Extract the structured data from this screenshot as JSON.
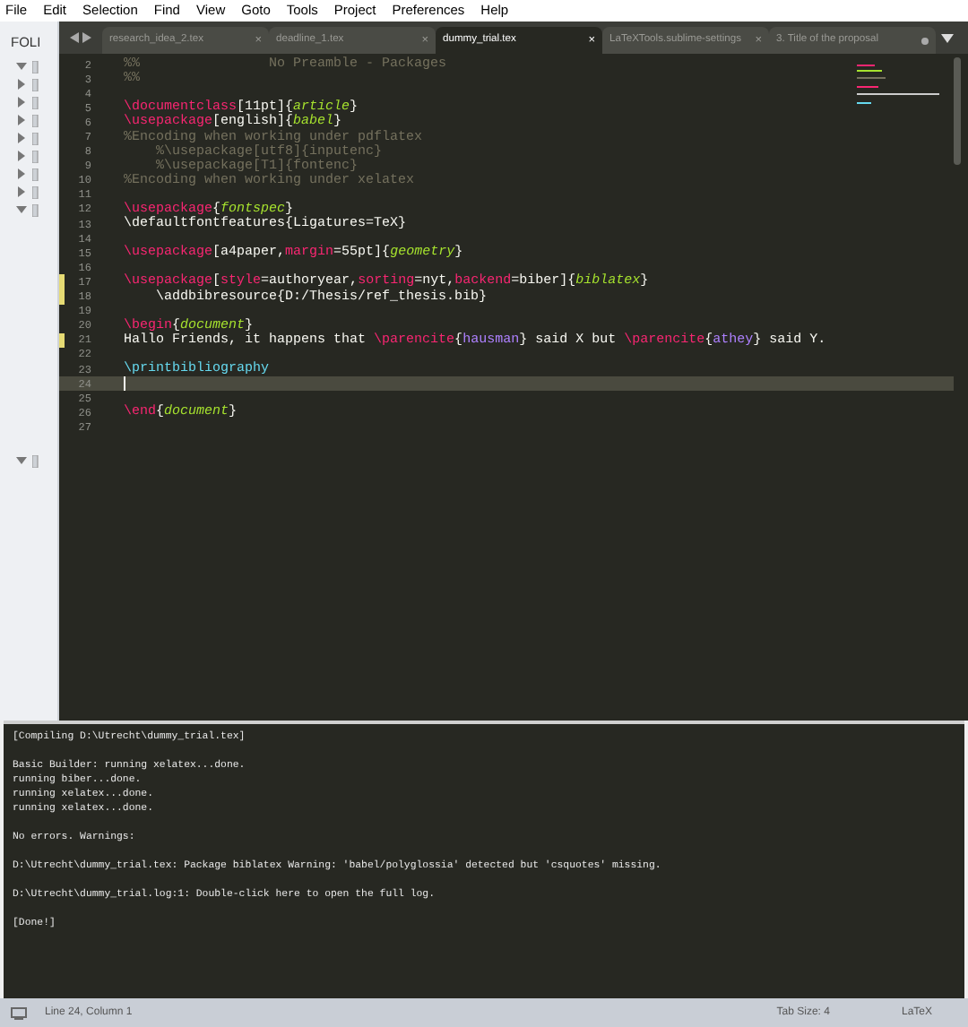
{
  "menu": [
    "File",
    "Edit",
    "Selection",
    "Find",
    "View",
    "Goto",
    "Tools",
    "Project",
    "Preferences",
    "Help"
  ],
  "sidebar": {
    "header": "FOLI",
    "items": [
      {
        "expanded": true
      },
      {
        "expanded": false
      },
      {
        "expanded": false
      },
      {
        "expanded": false
      },
      {
        "expanded": false
      },
      {
        "expanded": false
      },
      {
        "expanded": false
      },
      {
        "expanded": false
      },
      {
        "expanded": true
      },
      {
        "expanded": true
      }
    ]
  },
  "tabs": [
    {
      "label": "research_idea_2.tex",
      "close": "×",
      "selected": false,
      "dirty": false
    },
    {
      "label": "deadline_1.tex",
      "close": "×",
      "selected": false,
      "dirty": false
    },
    {
      "label": "dummy_trial.tex",
      "close": "×",
      "selected": true,
      "dirty": false
    },
    {
      "label": "LaTeXTools.sublime-settings",
      "close": "×",
      "selected": false,
      "dirty": false
    },
    {
      "label": "3. Title of the proposal",
      "selected": false,
      "dirty": true
    }
  ],
  "editor": {
    "lines": [
      {
        "number": "2",
        "modified": false,
        "current": false,
        "tokens": [
          {
            "kind": "comment",
            "text": "%%                No Preamble - Packages"
          }
        ]
      },
      {
        "number": "3",
        "modified": false,
        "current": false,
        "tokens": [
          {
            "kind": "comment",
            "text": "%%"
          }
        ]
      },
      {
        "number": "4",
        "modified": false,
        "current": false
      },
      {
        "number": "5",
        "modified": false,
        "current": false,
        "tokens": [
          {
            "kind": "cmd",
            "text": "\\documentclass"
          },
          {
            "kind": "plain",
            "text": "[11pt]{"
          },
          {
            "kind": "arg",
            "text": "article"
          },
          {
            "kind": "plain",
            "text": "}"
          }
        ]
      },
      {
        "number": "6",
        "modified": false,
        "current": false,
        "tokens": [
          {
            "kind": "cmd",
            "text": "\\usepackage"
          },
          {
            "kind": "plain",
            "text": "[english]{"
          },
          {
            "kind": "arg",
            "text": "babel"
          },
          {
            "kind": "plain",
            "text": "}"
          }
        ]
      },
      {
        "number": "7",
        "modified": false,
        "current": false,
        "tokens": [
          {
            "kind": "comment",
            "text": "%Encoding when working under pdflatex"
          }
        ]
      },
      {
        "number": "8",
        "modified": false,
        "current": false,
        "tokens": [
          {
            "kind": "comment",
            "text": "    %\\usepackage[utf8]{inputenc}"
          }
        ]
      },
      {
        "number": "9",
        "modified": false,
        "current": false,
        "tokens": [
          {
            "kind": "comment",
            "text": "    %\\usepackage[T1]{fontenc}"
          }
        ]
      },
      {
        "number": "10",
        "modified": false,
        "current": false,
        "tokens": [
          {
            "kind": "comment",
            "text": "%Encoding when working under xelatex"
          }
        ]
      },
      {
        "number": "11",
        "modified": false,
        "current": false
      },
      {
        "number": "12",
        "modified": false,
        "current": false,
        "tokens": [
          {
            "kind": "cmd",
            "text": "\\usepackage"
          },
          {
            "kind": "plain",
            "text": "{"
          },
          {
            "kind": "arg",
            "text": "fontspec"
          },
          {
            "kind": "plain",
            "text": "}"
          }
        ]
      },
      {
        "number": "13",
        "modified": false,
        "current": false,
        "tokens": [
          {
            "kind": "plain",
            "text": "\\defaultfontfeatures{Ligatures=TeX}"
          }
        ]
      },
      {
        "number": "14",
        "modified": false,
        "current": false
      },
      {
        "number": "15",
        "modified": false,
        "current": false,
        "tokens": [
          {
            "kind": "cmd",
            "text": "\\usepackage"
          },
          {
            "kind": "plain",
            "text": "[a4paper,"
          },
          {
            "kind": "cmd",
            "text": "margin"
          },
          {
            "kind": "plain",
            "text": "=55pt]{"
          },
          {
            "kind": "arg",
            "text": "geometry"
          },
          {
            "kind": "plain",
            "text": "}"
          }
        ]
      },
      {
        "number": "16",
        "modified": false,
        "current": false
      },
      {
        "number": "17",
        "modified": true,
        "current": false,
        "tokens": [
          {
            "kind": "cmd",
            "text": "\\usepackage"
          },
          {
            "kind": "plain",
            "text": "["
          },
          {
            "kind": "cmd",
            "text": "style"
          },
          {
            "kind": "plain",
            "text": "=authoryear,"
          },
          {
            "kind": "cmd",
            "text": "sorting"
          },
          {
            "kind": "plain",
            "text": "=nyt,"
          },
          {
            "kind": "cmd",
            "text": "backend"
          },
          {
            "kind": "plain",
            "text": "=biber]{"
          },
          {
            "kind": "arg",
            "text": "biblatex"
          },
          {
            "kind": "plain",
            "text": "}"
          }
        ]
      },
      {
        "number": "18",
        "modified": true,
        "current": false,
        "tokens": [
          {
            "kind": "plain",
            "text": "    \\addbibresource{D:/Thesis/ref_thesis.bib}"
          }
        ]
      },
      {
        "number": "19",
        "modified": false,
        "current": false
      },
      {
        "number": "20",
        "modified": false,
        "current": false,
        "tokens": [
          {
            "kind": "cmd",
            "text": "\\begin"
          },
          {
            "kind": "plain",
            "text": "{"
          },
          {
            "kind": "arg",
            "text": "document"
          },
          {
            "kind": "plain",
            "text": "}"
          }
        ]
      },
      {
        "number": "21",
        "modified": true,
        "current": false,
        "tokens": [
          {
            "kind": "plain",
            "text": "Hallo Friends, it happens that "
          },
          {
            "kind": "cmd",
            "text": "\\parencite"
          },
          {
            "kind": "plain",
            "text": "{"
          },
          {
            "kind": "ref",
            "text": "hausman"
          },
          {
            "kind": "plain",
            "text": "} said X but "
          },
          {
            "kind": "cmd",
            "text": "\\parencite"
          },
          {
            "kind": "plain",
            "text": "{"
          },
          {
            "kind": "ref",
            "text": "athey"
          },
          {
            "kind": "plain",
            "text": "} said Y."
          }
        ]
      },
      {
        "number": "22",
        "modified": false,
        "current": false
      },
      {
        "number": "23",
        "modified": false,
        "current": false,
        "tokens": [
          {
            "kind": "func",
            "text": "\\printbibliography"
          }
        ]
      },
      {
        "number": "24",
        "modified": false,
        "current": true
      },
      {
        "number": "25",
        "modified": false,
        "current": false
      },
      {
        "number": "26",
        "modified": false,
        "current": false,
        "tokens": [
          {
            "kind": "cmd",
            "text": "\\end"
          },
          {
            "kind": "plain",
            "text": "{"
          },
          {
            "kind": "arg",
            "text": "document"
          },
          {
            "kind": "plain",
            "text": "}"
          }
        ]
      },
      {
        "number": "27",
        "modified": false,
        "current": false
      }
    ]
  },
  "output": {
    "blocks": [
      [
        "[Compiling D:\\Utrecht\\dummy_trial.tex]"
      ],
      [
        "Basic Builder: running xelatex...done.",
        "running biber...done.",
        "running xelatex...done.",
        "running xelatex...done."
      ],
      [
        "No errors. Warnings:"
      ],
      [
        "D:\\Utrecht\\dummy_trial.tex: Package biblatex Warning: 'babel/polyglossia' detected but 'csquotes' missing."
      ],
      [
        "D:\\Utrecht\\dummy_trial.log:1: Double-click here to open the full log."
      ],
      [
        "[Done!]"
      ]
    ]
  },
  "status_bar": {
    "position": "Line 24, Column 1",
    "tab_size": "Tab Size: 4",
    "syntax": "LaTeX"
  }
}
